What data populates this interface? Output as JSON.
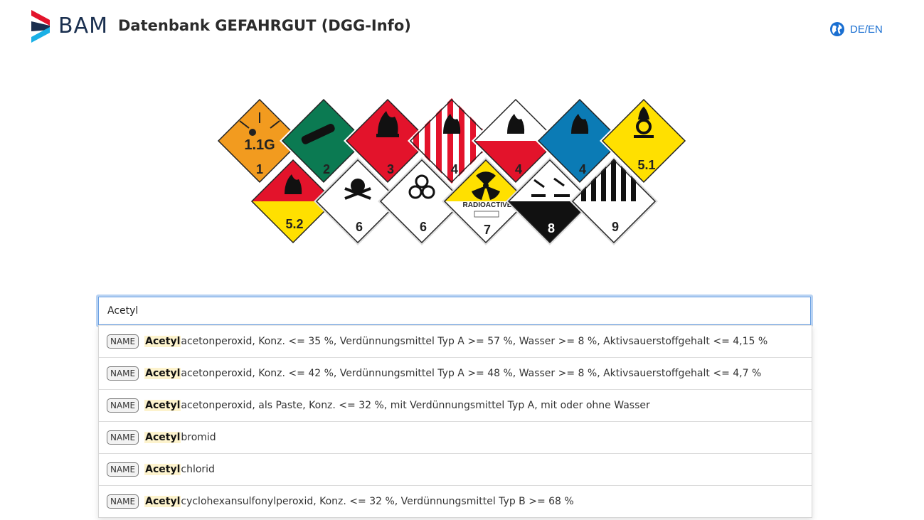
{
  "header": {
    "logo_text": "BAM",
    "title": "Datenbank GEFAHRGUT (DGG-Info)",
    "language_label": "DE/EN"
  },
  "hero": {
    "signs": [
      {
        "label": "1",
        "sublabel": "1.1G",
        "kind": "explosive",
        "color": "#f29b1f"
      },
      {
        "label": "2",
        "kind": "gas",
        "color": "#0b7a52"
      },
      {
        "label": "3",
        "kind": "flammable",
        "color": "#e3132b"
      },
      {
        "label": "4",
        "kind": "stripes",
        "color": "#e3132b"
      },
      {
        "label": "4",
        "kind": "white-red",
        "color": "#e3132b"
      },
      {
        "label": "4",
        "kind": "blue",
        "color": "#0b7bb5"
      },
      {
        "label": "5.1",
        "kind": "oxidizer",
        "color": "#ffe000"
      },
      {
        "label": "5.2",
        "kind": "peroxide",
        "color": "#e3132b"
      },
      {
        "label": "6",
        "kind": "toxic",
        "color": "#ffffff"
      },
      {
        "label": "6",
        "kind": "biohazard",
        "color": "#ffffff"
      },
      {
        "label": "7",
        "sublabel": "RADIOACTIVE",
        "kind": "radioactive",
        "color": "#ffe000"
      },
      {
        "label": "8",
        "kind": "corrosive",
        "color": "#111111"
      },
      {
        "label": "9",
        "kind": "misc",
        "color": "#ffffff"
      }
    ]
  },
  "search": {
    "value": "Acetyl",
    "placeholder": ""
  },
  "results": [
    {
      "badge": "NAME",
      "match": "Acetyl",
      "rest": "acetonperoxid, Konz. <= 35 %, Verdünnungsmittel Typ A >= 57 %, Wasser >= 8 %, Aktivsauerstoffgehalt <= 4,15 %"
    },
    {
      "badge": "NAME",
      "match": "Acetyl",
      "rest": "acetonperoxid, Konz. <= 42 %, Verdünnungsmittel Typ A >= 48 %, Wasser >= 8 %, Aktivsauerstoffgehalt <= 4,7 %"
    },
    {
      "badge": "NAME",
      "match": "Acetyl",
      "rest": "acetonperoxid, als Paste, Konz. <= 32 %, mit Verdünnungsmittel Typ A, mit oder ohne Wasser"
    },
    {
      "badge": "NAME",
      "match": "Acetyl",
      "rest": "bromid"
    },
    {
      "badge": "NAME",
      "match": "Acetyl",
      "rest": "chlorid"
    },
    {
      "badge": "NAME",
      "match": "Acetyl",
      "rest": "cyclohexansulfonylperoxid, Konz. <= 32 %, Verdünnungsmittel Typ B >= 68 %"
    }
  ],
  "colors": {
    "accent": "#1a6fd1",
    "logo_red": "#e3132b",
    "logo_blue": "#1ab0e6",
    "highlight": "#fdf3cd"
  },
  "icons": {
    "language": "globe-icon"
  }
}
